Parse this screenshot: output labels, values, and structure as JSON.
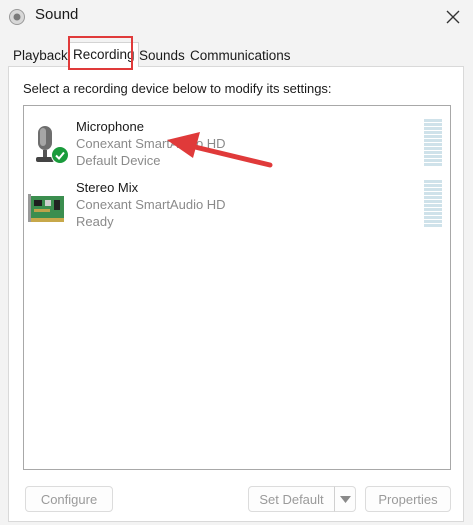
{
  "window": {
    "title": "Sound",
    "icon": "speaker-icon",
    "close_icon": "close-icon"
  },
  "tabs": [
    {
      "label": "Playback",
      "active": false
    },
    {
      "label": "Recording",
      "active": true
    },
    {
      "label": "Sounds",
      "active": false
    },
    {
      "label": "Communications",
      "active": false
    }
  ],
  "instruction": "Select a recording device below to modify its settings:",
  "devices": [
    {
      "name": "Microphone",
      "driver": "Conexant SmartAudio HD",
      "status": "Default Device",
      "icon": "microphone-icon",
      "default_badge": "check-badge-icon"
    },
    {
      "name": "Stereo Mix",
      "driver": "Conexant SmartAudio HD",
      "status": "Ready",
      "icon": "sound-card-icon"
    }
  ],
  "buttons": {
    "configure": "Configure",
    "set_default": "Set Default",
    "properties": "Properties"
  },
  "colors": {
    "highlight": "#e03a3a",
    "meter": "#cfe2ea",
    "badge": "#1a9b3c"
  }
}
